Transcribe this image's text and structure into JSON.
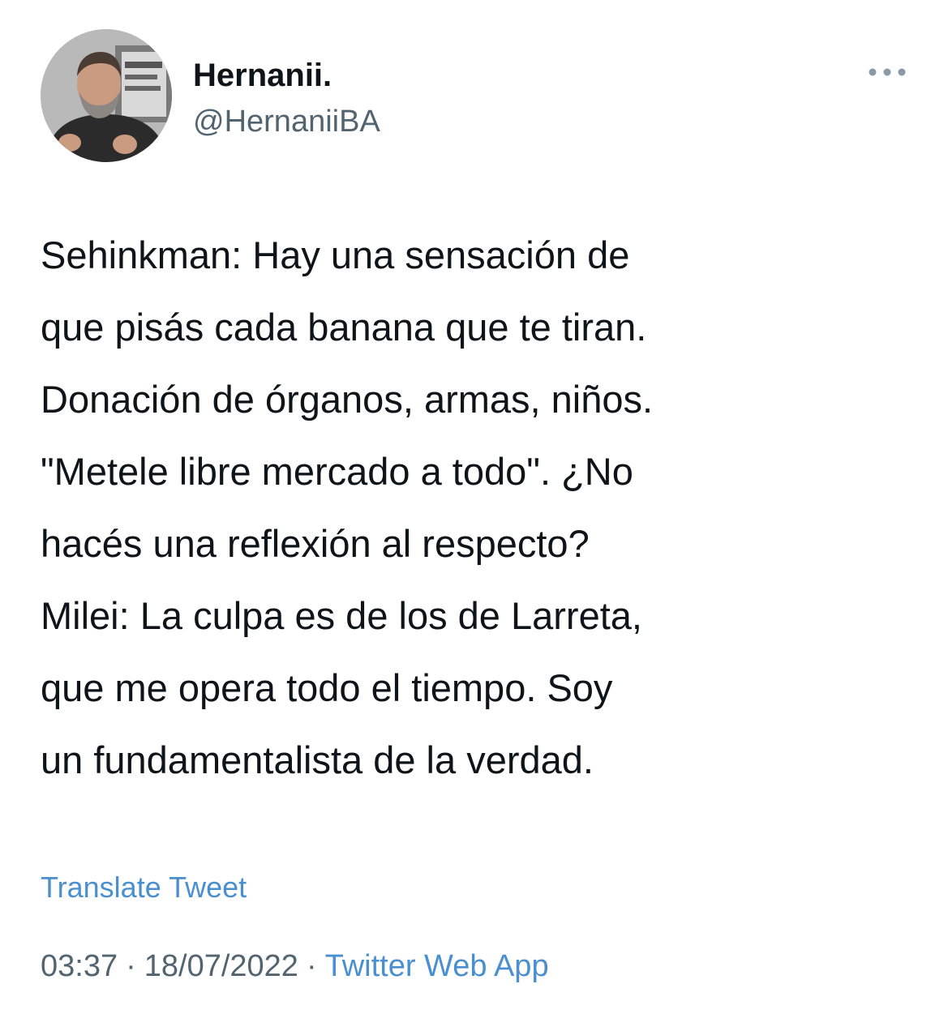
{
  "author": {
    "display_name": "Hernanii.",
    "handle": "@HernaniiBA",
    "avatar_icon": "user-avatar-photo"
  },
  "menu": {
    "icon": "more-horizontal-icon"
  },
  "tweet": {
    "paragraphs": [
      "Sehinkman: Hay una sensación de\nque pisás cada banana que te tiran.\nDonación de órganos, armas, niños.\n\"Metele libre mercado a todo\". ¿No\nhacés una reflexión al respecto?",
      "Milei: La culpa es de los de Larreta,\nque me opera todo el tiempo. Soy\nun fundamentalista de la verdad."
    ],
    "translate_label": "Translate Tweet",
    "time": "03:37",
    "date": "18/07/2022",
    "separator": "·",
    "source": "Twitter Web App"
  },
  "colors": {
    "text": "#0f1419",
    "secondary": "#536471",
    "link": "#4a8fd0",
    "background": "#ffffff"
  }
}
